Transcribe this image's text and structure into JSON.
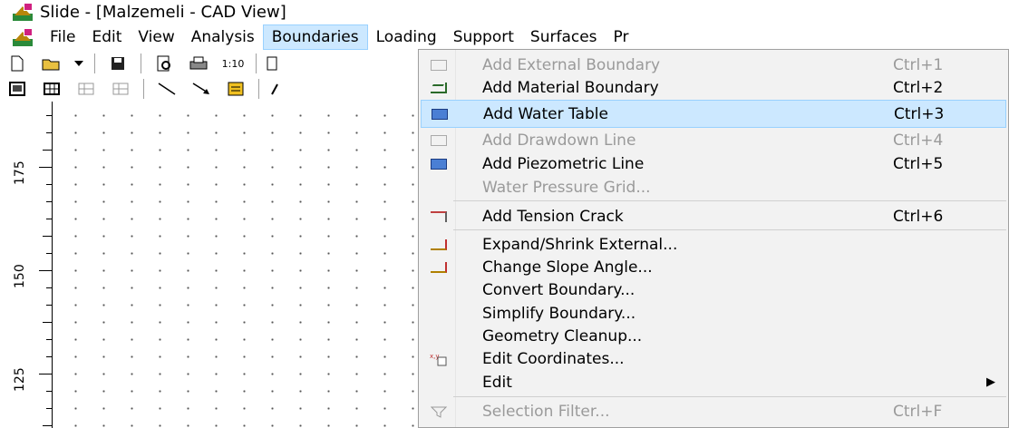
{
  "window": {
    "title": "Slide - [Malzemeli - CAD View]"
  },
  "menubar": {
    "items": [
      {
        "label": "File"
      },
      {
        "label": "Edit"
      },
      {
        "label": "View"
      },
      {
        "label": "Analysis"
      },
      {
        "label": "Boundaries"
      },
      {
        "label": "Loading"
      },
      {
        "label": "Support"
      },
      {
        "label": "Surfaces"
      },
      {
        "label": "Pr"
      }
    ]
  },
  "toolbar1": {
    "scale_label": "1:10"
  },
  "ruler": {
    "labels": [
      "175",
      "150",
      "125"
    ]
  },
  "dropdown": {
    "items": [
      {
        "label": "Add External Boundary",
        "shortcut": "Ctrl+1"
      },
      {
        "label": "Add Material Boundary",
        "shortcut": "Ctrl+2"
      },
      {
        "label": "Add Water Table",
        "shortcut": "Ctrl+3"
      },
      {
        "label": "Add Drawdown Line",
        "shortcut": "Ctrl+4"
      },
      {
        "label": "Add Piezometric Line",
        "shortcut": "Ctrl+5"
      },
      {
        "label": "Water Pressure Grid...",
        "shortcut": ""
      },
      {
        "label": "Add Tension Crack",
        "shortcut": "Ctrl+6"
      },
      {
        "label": "Expand/Shrink External...",
        "shortcut": ""
      },
      {
        "label": "Change Slope Angle...",
        "shortcut": ""
      },
      {
        "label": "Convert Boundary...",
        "shortcut": ""
      },
      {
        "label": "Simplify Boundary...",
        "shortcut": ""
      },
      {
        "label": "Geometry Cleanup...",
        "shortcut": ""
      },
      {
        "label": "Edit Coordinates...",
        "shortcut": ""
      },
      {
        "label": "Edit",
        "shortcut": ""
      },
      {
        "label": "Selection Filter...",
        "shortcut": "Ctrl+F"
      }
    ]
  },
  "colors": {
    "highlight": "#cce8ff",
    "highlight_border": "#99d1ff",
    "disabled_text": "#9a9a9a"
  }
}
